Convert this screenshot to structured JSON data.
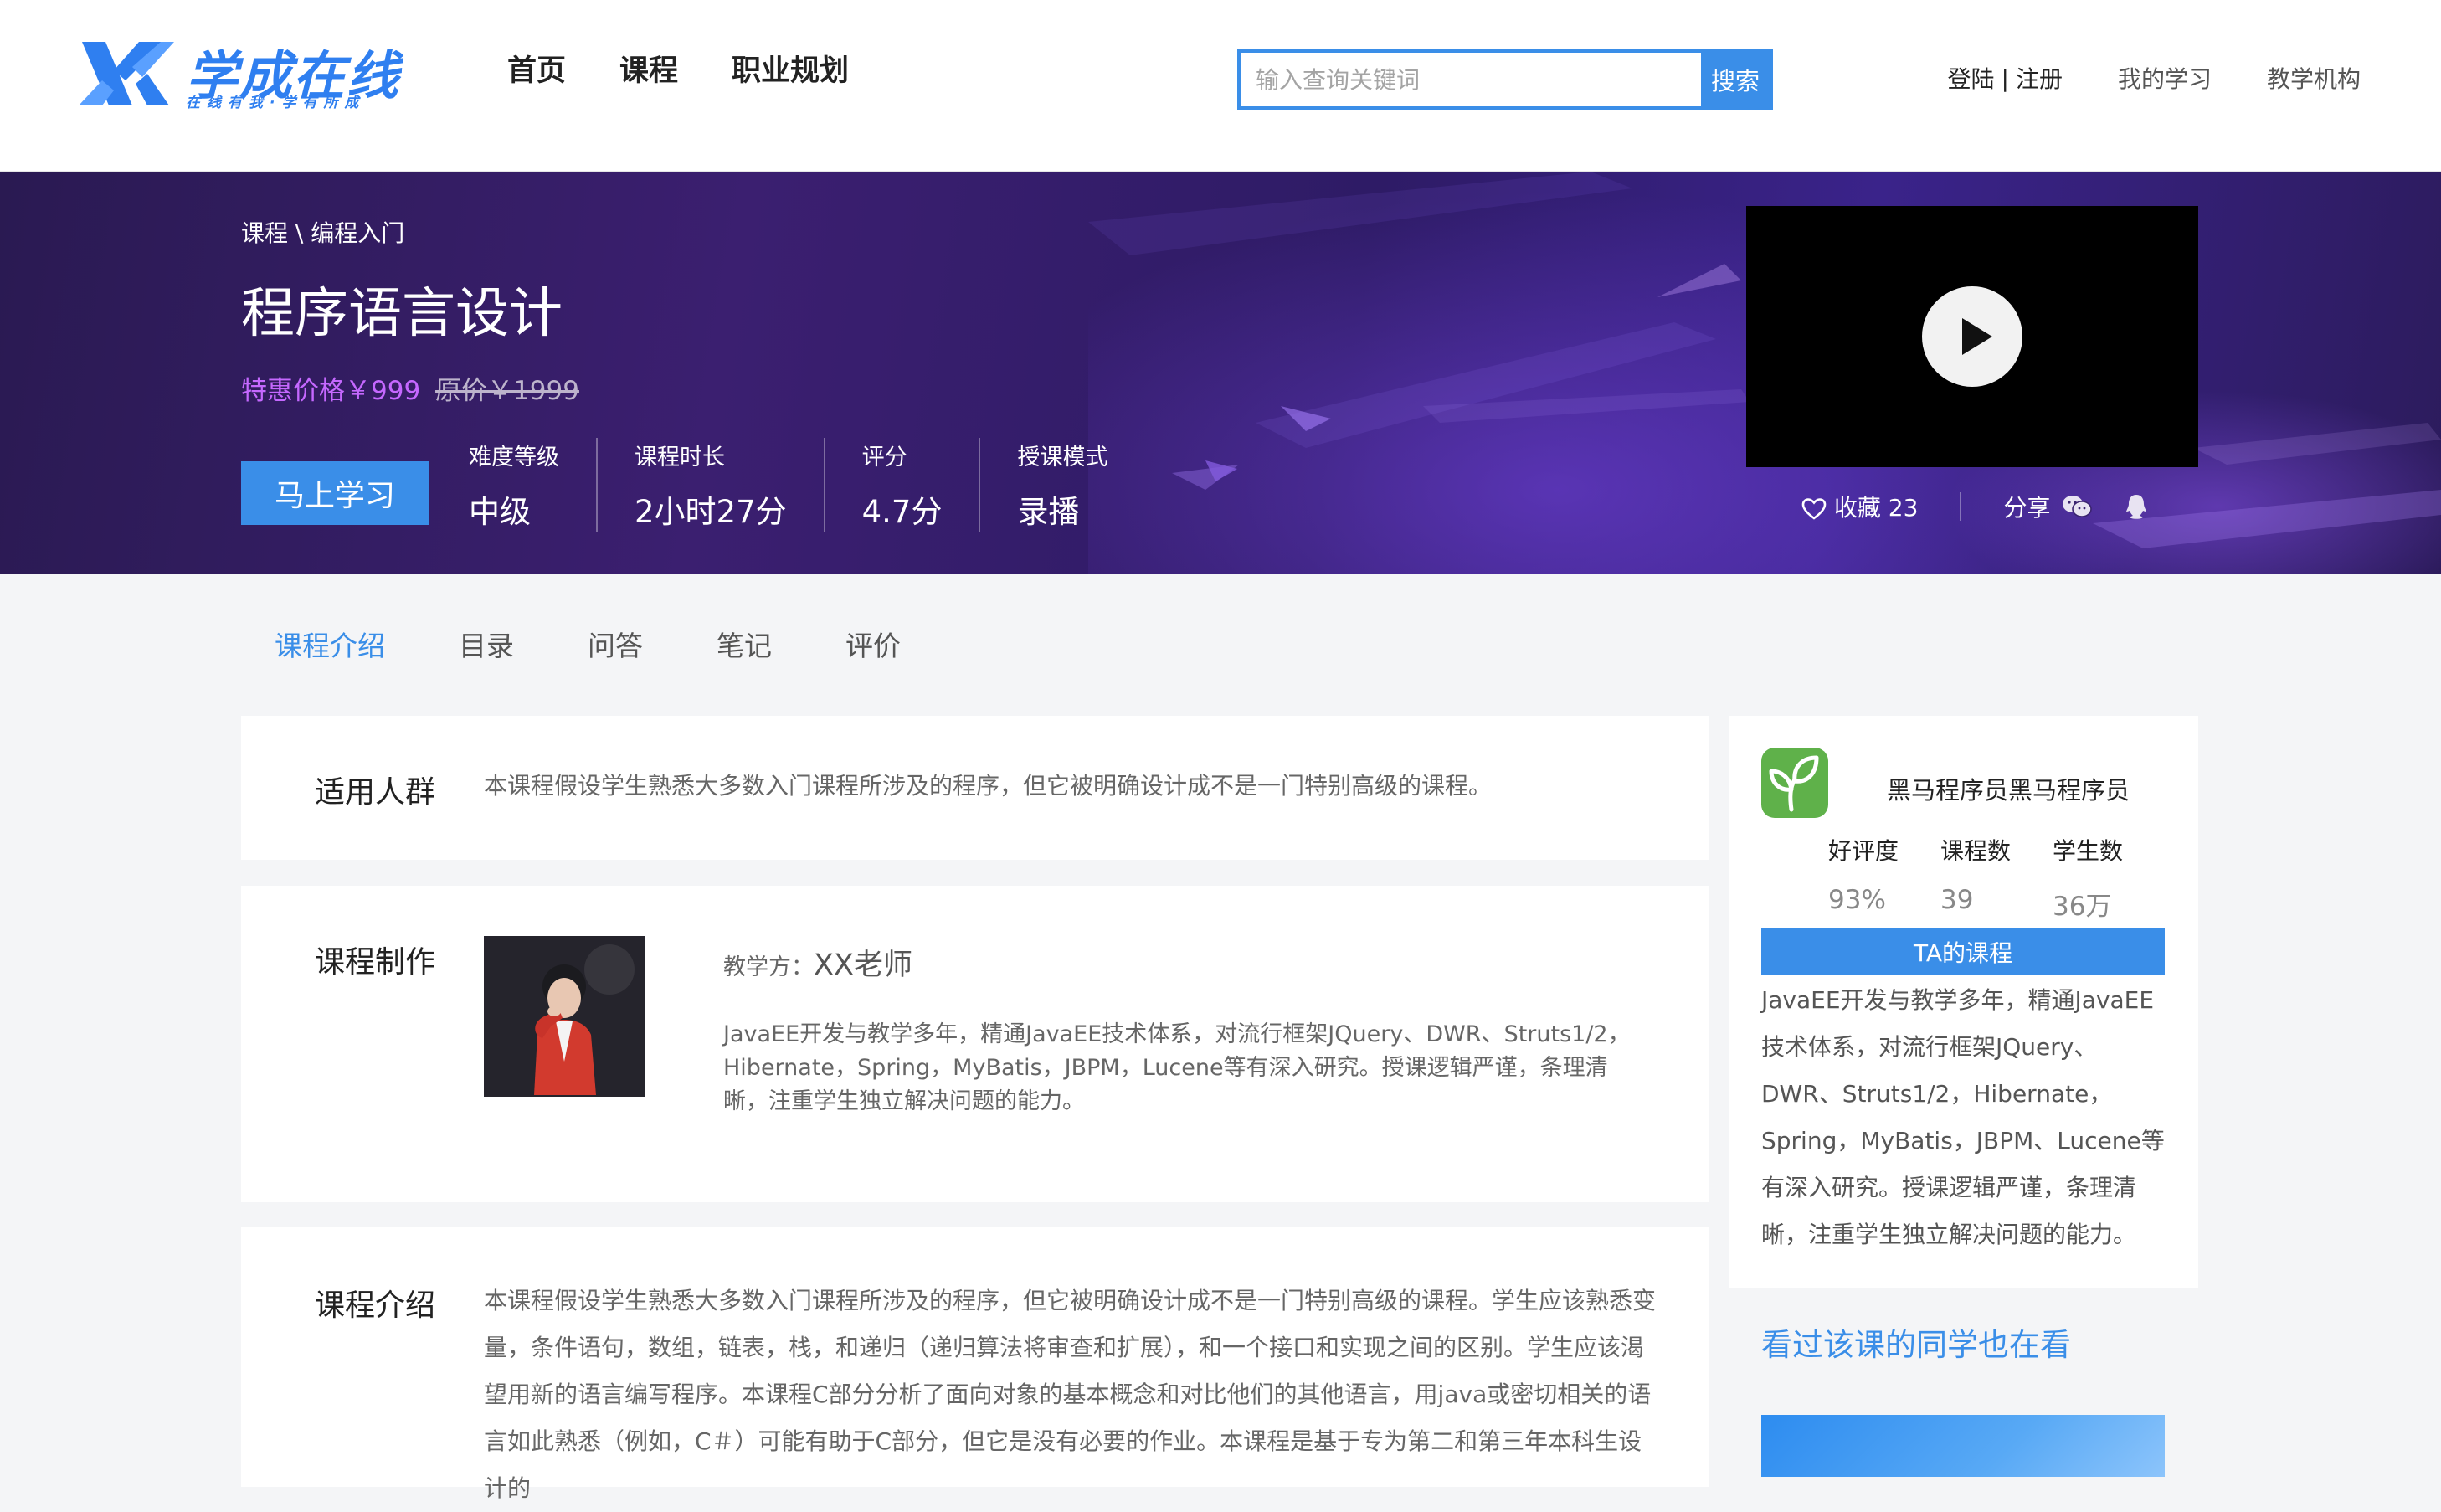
{
  "header": {
    "logo_text": "学成在线",
    "logo_slogan": "在线有我·学有所成",
    "nav": [
      "首页",
      "课程",
      "职业规划"
    ],
    "search_placeholder": "输入查询关键词",
    "search_button": "搜索",
    "login": "登陆",
    "separator": "|",
    "register": "注册",
    "my_learning": "我的学习",
    "institution": "教学机构",
    "brand_color": "#2f7ff0"
  },
  "banner": {
    "breadcrumb": "课程 \\ 编程入门",
    "title": "程序语言设计",
    "price_special": "特惠价格￥999",
    "price_original": "原价￥1999",
    "study_button": "马上学习",
    "stats": [
      {
        "label": "难度等级",
        "value": "中级"
      },
      {
        "label": "课程时长",
        "value": "2小时27分"
      },
      {
        "label": "评分",
        "value": "4.7分"
      },
      {
        "label": "授课模式",
        "value": "录播"
      }
    ],
    "favorite_label": "收藏 23",
    "share_label": "分享",
    "icons": [
      "play-icon",
      "heart-icon",
      "wechat-icon",
      "qq-icon"
    ]
  },
  "tabs": [
    "课程介绍",
    "目录",
    "问答",
    "笔记",
    "评价"
  ],
  "audience": {
    "label": "适用人群",
    "text": "本课程假设学生熟悉大多数入门课程所涉及的程序，但它被明确设计成不是一门特别高级的课程。"
  },
  "production": {
    "label": "课程制作",
    "teacher_label": "教学方：",
    "teacher_name": "XX老师",
    "teacher_desc": "JavaEE开发与教学多年，精通JavaEE技术体系，对流行框架JQuery、DWR、Struts1/2，Hibernate，Spring，MyBatis，JBPM，Lucene等有深入研究。授课逻辑严谨，条理清晰，注重学生独立解决问题的能力。"
  },
  "intro": {
    "label": "课程介绍",
    "text": "本课程假设学生熟悉大多数入门课程所涉及的程序，但它被明确设计成不是一门特别高级的课程。学生应该熟悉变量，条件语句，数组，链表，栈，和递归（递归算法将审查和扩展），和一个接口和实现之间的区别。学生应该渴望用新的语言编写程序。本课程C部分分析了面向对象的基本概念和对比他们的其他语言，用java或密切相关的语言如此熟悉（例如，C＃）可能有助于C部分，但它是没有必要的作业。本课程是基于专为第二和第三年本科生设计的"
  },
  "sidebar": {
    "org_name": "黑马程序员黑马程序员",
    "stats": [
      {
        "label": "好评度",
        "value": "93%"
      },
      {
        "label": "课程数",
        "value": "39"
      },
      {
        "label": "学生数",
        "value": "36万"
      }
    ],
    "ta_course": "TA的课程",
    "desc": "JavaEE开发与教学多年，精通JavaEE技术体系，对流行框架JQuery、DWR、Struts1/2，Hibernate，Spring，MyBatis，JBPM、Lucene等有深入研究。授课逻辑严谨，条理清晰，注重学生独立解决问题的能力。",
    "also_watching": "看过该课的同学也在看"
  }
}
